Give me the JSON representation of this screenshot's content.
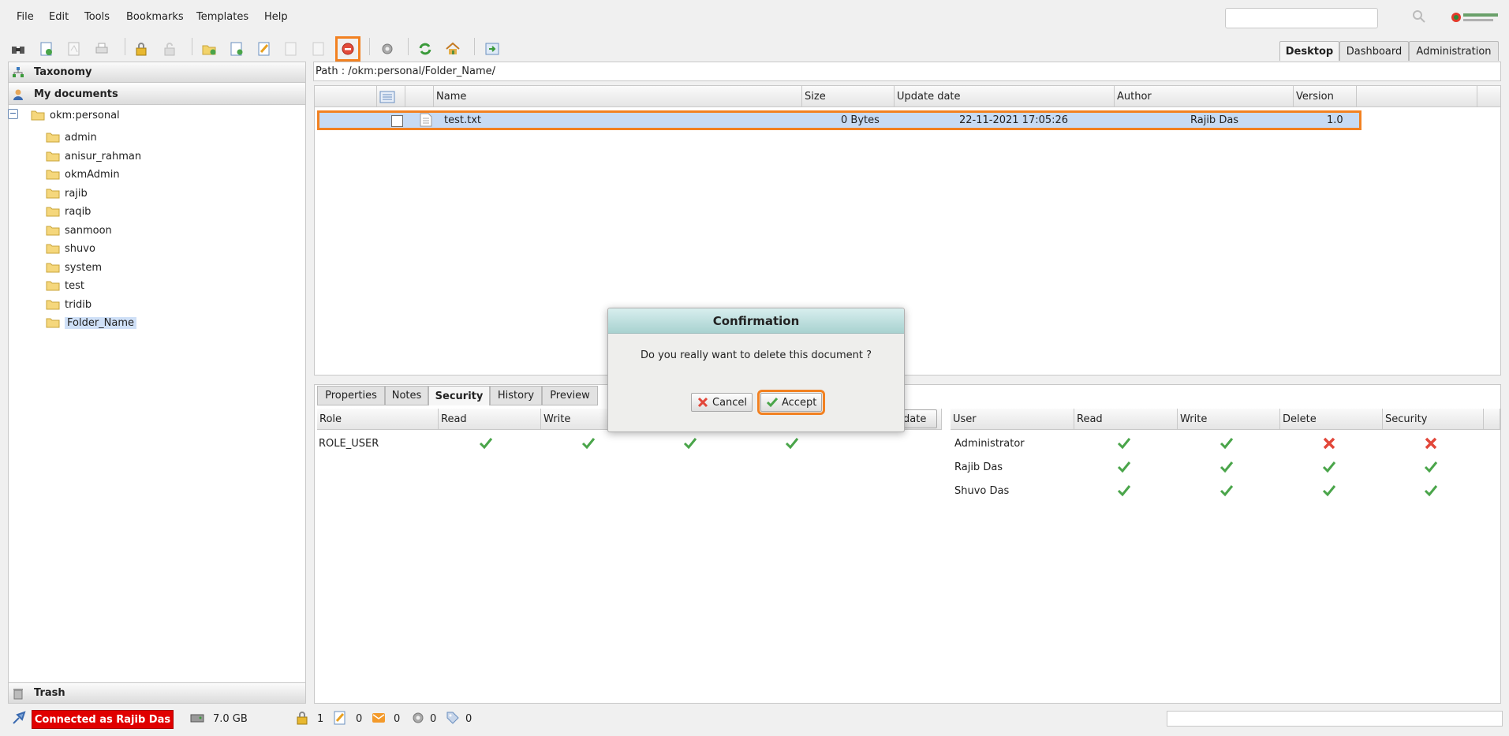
{
  "menu": {
    "file": "File",
    "edit": "Edit",
    "tools": "Tools",
    "bookmarks": "Bookmarks",
    "templates": "Templates",
    "help": "Help"
  },
  "search": {
    "placeholder": ""
  },
  "workspace_tabs": {
    "desktop": "Desktop",
    "dashboard": "Dashboard",
    "administration": "Administration"
  },
  "left_panel": {
    "taxonomy": "Taxonomy",
    "my_documents": "My documents",
    "trash": "Trash",
    "root": "okm:personal",
    "folders": [
      "admin",
      "anisur_rahman",
      "okmAdmin",
      "rajib",
      "raqib",
      "sanmoon",
      "shuvo",
      "system",
      "test",
      "tridib",
      "Folder_Name"
    ]
  },
  "path": "Path : /okm:personal/Folder_Name/",
  "grid": {
    "headers": {
      "name": "Name",
      "size": "Size",
      "update_date": "Update date",
      "author": "Author",
      "version": "Version"
    },
    "rows": [
      {
        "name": "test.txt",
        "size": "0 Bytes",
        "update_date": "22-11-2021 17:05:26",
        "author": "Rajib Das",
        "version": "1.0"
      }
    ]
  },
  "bottom_tabs": {
    "properties": "Properties",
    "notes": "Notes",
    "security": "Security",
    "history": "History",
    "preview": "Preview"
  },
  "security": {
    "role_headers": {
      "role": "Role",
      "read": "Read",
      "write": "Write"
    },
    "roles": [
      {
        "name": "ROLE_USER"
      }
    ],
    "update_button": "date",
    "user_headers": {
      "user": "User",
      "read": "Read",
      "write": "Write",
      "delete": "Delete",
      "security": "Security"
    },
    "users": [
      {
        "name": "Administrator",
        "read": true,
        "write": true,
        "delete": false,
        "security": false
      },
      {
        "name": "Rajib Das",
        "read": true,
        "write": true,
        "delete": true,
        "security": true
      },
      {
        "name": "Shuvo Das",
        "read": true,
        "write": true,
        "delete": true,
        "security": true
      }
    ]
  },
  "dialog": {
    "title": "Confirmation",
    "message": "Do you really want to delete this document ?",
    "cancel": "Cancel",
    "accept": "Accept"
  },
  "status": {
    "connected": "Connected as Rajib Das",
    "disk": "7.0 GB",
    "locked": "1",
    "checkout": "0",
    "mail": "0",
    "tasks": "0",
    "tags": "0"
  },
  "colors": {
    "accent_highlight": "#f28121",
    "connected_bg": "#e00000",
    "selection": "#c7dbf4"
  }
}
